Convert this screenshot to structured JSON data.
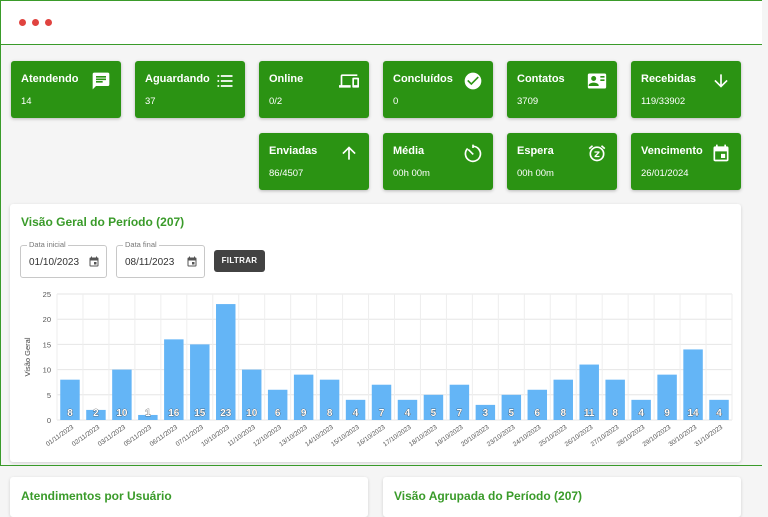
{
  "window": {
    "dots": [
      "#e0433f",
      "#e0433f",
      "#e0433f"
    ]
  },
  "cards": [
    {
      "title": "Atendendo",
      "value": "14",
      "icon": "chat-icon"
    },
    {
      "title": "Aguardando",
      "value": "37",
      "icon": "list-icon"
    },
    {
      "title": "Online",
      "value": "0/2",
      "icon": "devices-icon"
    },
    {
      "title": "Concluídos",
      "value": "0",
      "icon": "check-circle-icon"
    },
    {
      "title": "Contatos",
      "value": "3709",
      "icon": "contact-card-icon"
    },
    {
      "title": "Recebidas",
      "value": "119/33902",
      "icon": "arrow-down-icon"
    },
    {
      "title": "Enviadas",
      "value": "86/4507",
      "icon": "arrow-up-icon"
    },
    {
      "title": "Média",
      "value": "00h 00m",
      "icon": "timer-icon"
    },
    {
      "title": "Espera",
      "value": "00h 00m",
      "icon": "alarm-snooze-icon"
    },
    {
      "title": "Vencimento",
      "value": "26/01/2024",
      "icon": "calendar-icon"
    }
  ],
  "overview": {
    "title": "Visão Geral do Período (207)",
    "start_label": "Data inicial",
    "start_value": "01/10/2023",
    "end_label": "Data final",
    "end_value": "08/11/2023",
    "filter_label": "FILTRAR"
  },
  "bottom": {
    "left_title": "Atendimentos por Usuário",
    "right_title": "Visão Agrupada do Período (207)"
  },
  "colors": {
    "accent": "#2b9313",
    "bar": "#64b5f6"
  },
  "chart_data": {
    "type": "bar",
    "ylabel": "Visão Geral",
    "xlabel": "",
    "ylim": [
      0,
      25
    ],
    "yticks": [
      0,
      5,
      10,
      15,
      20,
      25
    ],
    "grid": true,
    "categories": [
      "01/11/2023",
      "02/11/2023",
      "03/11/2023",
      "05/11/2023",
      "06/11/2023",
      "07/11/2023",
      "10/10/2023",
      "11/10/2023",
      "12/10/2023",
      "13/10/2023",
      "14/10/2023",
      "15/10/2023",
      "16/10/2023",
      "17/10/2023",
      "18/10/2023",
      "19/10/2023",
      "20/10/2023",
      "23/10/2023",
      "24/10/2023",
      "25/10/2023",
      "26/10/2023",
      "27/10/2023",
      "28/10/2023",
      "29/10/2023",
      "30/10/2023",
      "31/10/2023"
    ],
    "values": [
      8,
      2,
      10,
      1,
      16,
      15,
      23,
      10,
      6,
      9,
      8,
      4,
      7,
      4,
      5,
      7,
      3,
      5,
      6,
      8,
      11,
      8,
      4,
      9,
      14,
      4
    ]
  }
}
